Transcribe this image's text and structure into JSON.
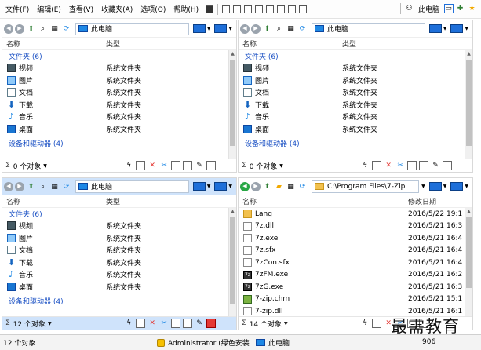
{
  "menubar": {
    "items": [
      "文件(F)",
      "编辑(E)",
      "查看(V)",
      "收藏夹(A)",
      "选项(O)",
      "帮助(H)"
    ],
    "right_label": "此电脑"
  },
  "panes": {
    "top_left": {
      "address": "此电脑",
      "columns": {
        "name": "名称",
        "type": "类型"
      },
      "group_folders": "文件夹 (6)",
      "rows": [
        {
          "icon": "video-icon",
          "name": "视频",
          "type": "系统文件夹"
        },
        {
          "icon": "picture-icon",
          "name": "图片",
          "type": "系统文件夹"
        },
        {
          "icon": "document-icon",
          "name": "文档",
          "type": "系统文件夹"
        },
        {
          "icon": "download-icon",
          "name": "下载",
          "type": "系统文件夹"
        },
        {
          "icon": "music-icon",
          "name": "音乐",
          "type": "系统文件夹"
        },
        {
          "icon": "desktop-icon",
          "name": "桌面",
          "type": "系统文件夹"
        }
      ],
      "group_devices": "设备和驱动器 (4)",
      "status_count": "0 个对象"
    },
    "top_right": {
      "address": "此电脑",
      "columns": {
        "name": "名称",
        "type": "类型"
      },
      "group_folders": "文件夹 (6)",
      "rows": [
        {
          "icon": "video-icon",
          "name": "视频",
          "type": "系统文件夹"
        },
        {
          "icon": "picture-icon",
          "name": "图片",
          "type": "系统文件夹"
        },
        {
          "icon": "document-icon",
          "name": "文档",
          "type": "系统文件夹"
        },
        {
          "icon": "download-icon",
          "name": "下载",
          "type": "系统文件夹"
        },
        {
          "icon": "music-icon",
          "name": "音乐",
          "type": "系统文件夹"
        },
        {
          "icon": "desktop-icon",
          "name": "桌面",
          "type": "系统文件夹"
        }
      ],
      "group_devices": "设备和驱动器 (4)",
      "status_count": "0 个对象"
    },
    "bottom_left": {
      "address": "此电脑",
      "columns": {
        "name": "名称",
        "type": "类型"
      },
      "group_folders": "文件夹 (6)",
      "rows": [
        {
          "icon": "video-icon",
          "name": "视频",
          "type": "系统文件夹"
        },
        {
          "icon": "picture-icon",
          "name": "图片",
          "type": "系统文件夹"
        },
        {
          "icon": "document-icon",
          "name": "文档",
          "type": "系统文件夹"
        },
        {
          "icon": "download-icon",
          "name": "下载",
          "type": "系统文件夹"
        },
        {
          "icon": "music-icon",
          "name": "音乐",
          "type": "系统文件夹"
        },
        {
          "icon": "desktop-icon",
          "name": "桌面",
          "type": "系统文件夹"
        }
      ],
      "group_devices": "设备和驱动器 (4)",
      "status_count": "12 个对象"
    },
    "bottom_right": {
      "address": "C:\\Program Files\\7-Zip",
      "columns": {
        "name": "名称",
        "date": "修改日期"
      },
      "rows": [
        {
          "icon": "folder-icon",
          "name": "Lang",
          "date": "2016/5/22 19:1"
        },
        {
          "icon": "file-icon",
          "name": "7z.dll",
          "date": "2016/5/21 16:3"
        },
        {
          "icon": "exe-icon",
          "name": "7z.exe",
          "date": "2016/5/21 16:4"
        },
        {
          "icon": "file-icon",
          "name": "7z.sfx",
          "date": "2016/5/21 16:4"
        },
        {
          "icon": "file-icon",
          "name": "7zCon.sfx",
          "date": "2016/5/21 16:4"
        },
        {
          "icon": "exe-icon",
          "name": "7zFM.exe",
          "date": "2016/5/21 16:2"
        },
        {
          "icon": "exe-icon",
          "name": "7zG.exe",
          "date": "2016/5/21 16:3"
        },
        {
          "icon": "chm-icon",
          "name": "7-zip.chm",
          "date": "2016/5/21 15:1"
        },
        {
          "icon": "file-icon",
          "name": "7-zip.dll",
          "date": "2016/5/21 16:1"
        }
      ],
      "status_count": "14 个对象"
    }
  },
  "bottombar": {
    "left": "12 个对象",
    "admin": "Administrator (绿色安装",
    "pc": "此电脑",
    "number": "906"
  },
  "watermark": "最需教育"
}
